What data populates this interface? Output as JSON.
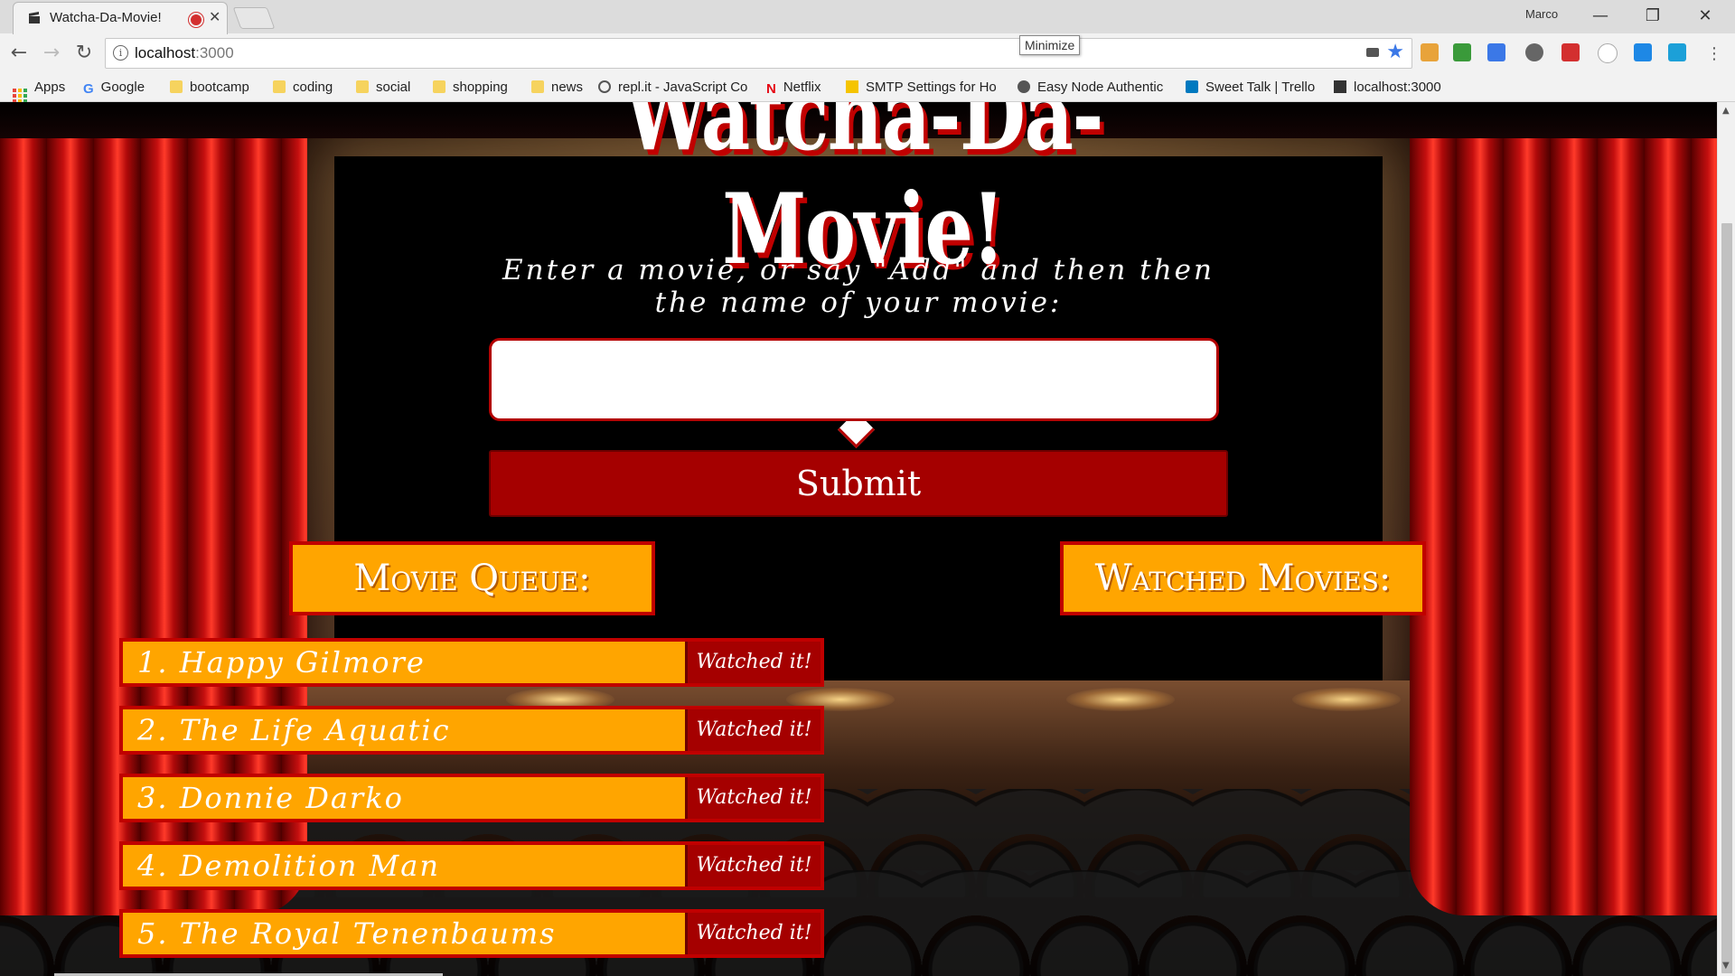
{
  "browser": {
    "tab_title": "Watcha-Da-Movie!",
    "profile_name": "Marco",
    "url_host": "localhost",
    "url_port": ":3000",
    "tooltip": "Minimize",
    "bookmarks": [
      {
        "label": "Apps",
        "icon": "apps-grid-icon"
      },
      {
        "label": "Google",
        "icon": "google-icon"
      },
      {
        "label": "bootcamp",
        "icon": "folder-icon"
      },
      {
        "label": "coding",
        "icon": "folder-icon"
      },
      {
        "label": "social",
        "icon": "folder-icon"
      },
      {
        "label": "shopping",
        "icon": "folder-icon"
      },
      {
        "label": "news",
        "icon": "folder-icon"
      },
      {
        "label": "repl.it - JavaScript Co",
        "icon": "replit-icon"
      },
      {
        "label": "Netflix",
        "icon": "netflix-icon"
      },
      {
        "label": "SMTP Settings for Ho",
        "icon": "smtp-icon"
      },
      {
        "label": "Easy Node Authentic",
        "icon": "node-auth-icon"
      },
      {
        "label": "Sweet Talk | Trello",
        "icon": "trello-icon"
      },
      {
        "label": "localhost:3000",
        "icon": "page-icon"
      }
    ]
  },
  "app": {
    "logo_text": "Watcha-Da-Movie!",
    "prompt": "Enter a movie, or say \"Add\" and then then the name of your movie:",
    "input_value": "",
    "submit_label": "Submit",
    "queue_header": "Movie Queue:",
    "watched_header": "Watched Movies:",
    "watched_button_label": "Watched it!",
    "queue": [
      "1. Happy Gilmore",
      "2. The Life Aquatic",
      "3. Donnie Darko",
      "4. Demolition Man",
      "5. The Royal Tenenbaums"
    ],
    "watched": []
  },
  "colors": {
    "accent_orange": "#ffa500",
    "accent_red": "#c00000",
    "button_red": "#a50000"
  }
}
